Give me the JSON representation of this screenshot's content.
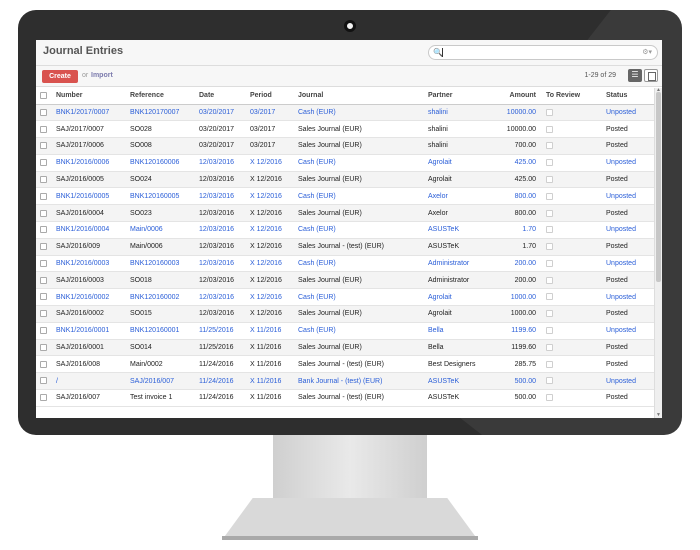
{
  "app": {
    "title": "Journal Entries",
    "search_placeholder": "",
    "search_icon": "search-icon",
    "create_label": "Create",
    "or_label": "or",
    "import_label": "Import",
    "pager": "1-29 of 29"
  },
  "columns": [
    "Number",
    "Reference",
    "Date",
    "Period",
    "Journal",
    "Partner",
    "Amount",
    "To Review",
    "Status"
  ],
  "rows": [
    {
      "number": "BNK1/2017/0007",
      "reference": "BNK120170007",
      "date": "03/20/2017",
      "period": "03/2017",
      "journal": "Cash (EUR)",
      "partner": "shalini",
      "amount": "10000.00",
      "status": "Unposted"
    },
    {
      "number": "SAJ/2017/0007",
      "reference": "SO028",
      "date": "03/20/2017",
      "period": "03/2017",
      "journal": "Sales Journal (EUR)",
      "partner": "shalini",
      "amount": "10000.00",
      "status": "Posted"
    },
    {
      "number": "SAJ/2017/0006",
      "reference": "SO008",
      "date": "03/20/2017",
      "period": "03/2017",
      "journal": "Sales Journal (EUR)",
      "partner": "shalini",
      "amount": "700.00",
      "status": "Posted"
    },
    {
      "number": "BNK1/2016/0006",
      "reference": "BNK120160006",
      "date": "12/03/2016",
      "period": "X 12/2016",
      "journal": "Cash (EUR)",
      "partner": "Agrolait",
      "amount": "425.00",
      "status": "Unposted"
    },
    {
      "number": "SAJ/2016/0005",
      "reference": "SO024",
      "date": "12/03/2016",
      "period": "X 12/2016",
      "journal": "Sales Journal (EUR)",
      "partner": "Agrolait",
      "amount": "425.00",
      "status": "Posted"
    },
    {
      "number": "BNK1/2016/0005",
      "reference": "BNK120160005",
      "date": "12/03/2016",
      "period": "X 12/2016",
      "journal": "Cash (EUR)",
      "partner": "Axelor",
      "amount": "800.00",
      "status": "Unposted"
    },
    {
      "number": "SAJ/2016/0004",
      "reference": "SO023",
      "date": "12/03/2016",
      "period": "X 12/2016",
      "journal": "Sales Journal (EUR)",
      "partner": "Axelor",
      "amount": "800.00",
      "status": "Posted"
    },
    {
      "number": "BNK1/2016/0004",
      "reference": "Main/0006",
      "date": "12/03/2016",
      "period": "X 12/2016",
      "journal": "Cash (EUR)",
      "partner": "ASUSTeK",
      "amount": "1.70",
      "status": "Unposted"
    },
    {
      "number": "SAJ/2016/009",
      "reference": "Main/0006",
      "date": "12/03/2016",
      "period": "X 12/2016",
      "journal": "Sales Journal - (test) (EUR)",
      "partner": "ASUSTeK",
      "amount": "1.70",
      "status": "Posted"
    },
    {
      "number": "BNK1/2016/0003",
      "reference": "BNK120160003",
      "date": "12/03/2016",
      "period": "X 12/2016",
      "journal": "Cash (EUR)",
      "partner": "Administrator",
      "amount": "200.00",
      "status": "Unposted"
    },
    {
      "number": "SAJ/2016/0003",
      "reference": "SO018",
      "date": "12/03/2016",
      "period": "X 12/2016",
      "journal": "Sales Journal (EUR)",
      "partner": "Administrator",
      "amount": "200.00",
      "status": "Posted"
    },
    {
      "number": "BNK1/2016/0002",
      "reference": "BNK120160002",
      "date": "12/03/2016",
      "period": "X 12/2016",
      "journal": "Cash (EUR)",
      "partner": "Agrolait",
      "amount": "1000.00",
      "status": "Unposted"
    },
    {
      "number": "SAJ/2016/0002",
      "reference": "SO015",
      "date": "12/03/2016",
      "period": "X 12/2016",
      "journal": "Sales Journal (EUR)",
      "partner": "Agrolait",
      "amount": "1000.00",
      "status": "Posted"
    },
    {
      "number": "BNK1/2016/0001",
      "reference": "BNK120160001",
      "date": "11/25/2016",
      "period": "X 11/2016",
      "journal": "Cash (EUR)",
      "partner": "Bella",
      "amount": "1199.60",
      "status": "Unposted"
    },
    {
      "number": "SAJ/2016/0001",
      "reference": "SO014",
      "date": "11/25/2016",
      "period": "X 11/2016",
      "journal": "Sales Journal (EUR)",
      "partner": "Bella",
      "amount": "1199.60",
      "status": "Posted"
    },
    {
      "number": "SAJ/2016/008",
      "reference": "Main/0002",
      "date": "11/24/2016",
      "period": "X 11/2016",
      "journal": "Sales Journal - (test) (EUR)",
      "partner": "Best Designers",
      "amount": "285.75",
      "status": "Posted"
    },
    {
      "number": "/",
      "reference": "SAJ/2016/007",
      "date": "11/24/2016",
      "period": "X 11/2016",
      "journal": "Bank Journal - (test) (EUR)",
      "partner": "ASUSTeK",
      "amount": "500.00",
      "status": "Unposted"
    },
    {
      "number": "SAJ/2016/007",
      "reference": "Test invoice 1",
      "date": "11/24/2016",
      "period": "X 11/2016",
      "journal": "Sales Journal - (test) (EUR)",
      "partner": "ASUSTeK",
      "amount": "500.00",
      "status": "Posted"
    }
  ],
  "colors": {
    "accent_create": "#d9534f",
    "unposted_text": "#2a5ed8",
    "import_link": "#7c7bad"
  }
}
